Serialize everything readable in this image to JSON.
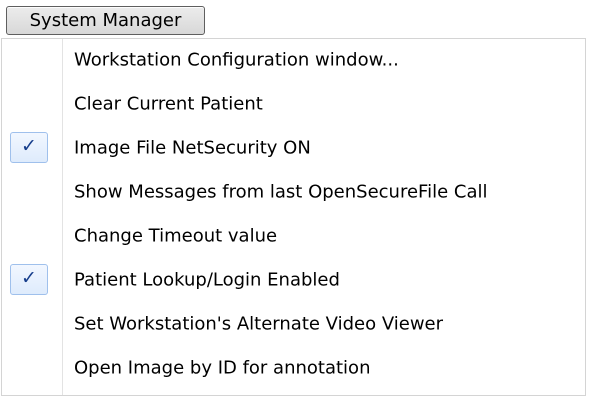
{
  "menu": {
    "title": "System Manager",
    "items": [
      {
        "label": "Workstation Configuration window...",
        "checked": false
      },
      {
        "label": "Clear Current Patient",
        "checked": false
      },
      {
        "label": "Image File NetSecurity ON",
        "checked": true
      },
      {
        "label": "Show Messages from last OpenSecureFile Call",
        "checked": false
      },
      {
        "label": "Change Timeout value",
        "checked": false
      },
      {
        "label": "Patient Lookup/Login Enabled",
        "checked": true
      },
      {
        "label": "Set Workstation's Alternate Video Viewer",
        "checked": false
      },
      {
        "label": "Open Image by ID for annotation",
        "checked": false
      }
    ],
    "check_glyph": "✓",
    "colors": {
      "check": "#173e8c",
      "check_background": "#deebfc",
      "check_border": "#9fc0ec"
    }
  }
}
